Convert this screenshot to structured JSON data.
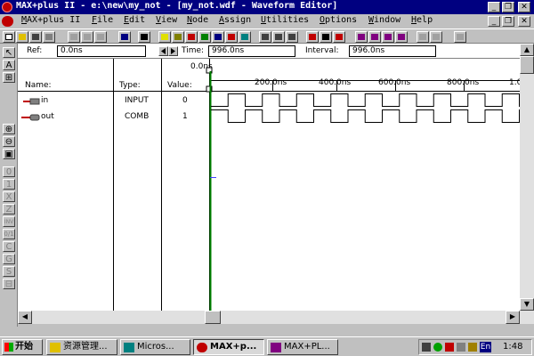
{
  "window": {
    "title": "MAX+plus II - e:\\new\\my_not - [my_not.wdf - Waveform Editor]",
    "controls": [
      "_",
      "❐",
      "✕"
    ],
    "mdi_controls": [
      "_",
      "❐",
      "✕"
    ]
  },
  "menu": [
    "MAX+plus II",
    "File",
    "Edit",
    "View",
    "Node",
    "Assign",
    "Utilities",
    "Options",
    "Window",
    "Help"
  ],
  "refbar": {
    "ref_label": "Ref:",
    "ref_value": "0.0ns",
    "time_label": "Time:",
    "time_value": "996.0ns",
    "interval_label": "Interval:",
    "interval_value": "996.0ns"
  },
  "palette": {
    "tools": [
      "↖",
      "A",
      "⊞",
      "⊕",
      "⊖",
      "▣",
      "0",
      "1",
      "X",
      "Z",
      "INV",
      "0/1",
      "C",
      "G",
      "S",
      "⊟"
    ]
  },
  "waveform": {
    "cursor_label": "0.0ns",
    "headers": {
      "name": "Name:",
      "type": "Type:",
      "value": "Value:"
    },
    "ticks": [
      "200.0ns",
      "400.0ns",
      "600.0ns",
      "800.0ns",
      "1.0"
    ],
    "signals": [
      {
        "name": "in",
        "type": "INPUT",
        "value": "0",
        "direction": "input"
      },
      {
        "name": "out",
        "type": "COMB",
        "value": "1",
        "direction": "output"
      }
    ]
  },
  "taskbar": {
    "start": "开始",
    "tasks": [
      "资源管理...",
      "Micros...",
      "MAX+p...",
      "MAX+PL..."
    ],
    "active_task": 2,
    "language": "En",
    "clock": "1:48"
  },
  "colors": {
    "titlebar": "#000080",
    "window_face": "#c0c0c0",
    "wave_bg": "#ffffff",
    "signal_in": "#c00000",
    "signal_out": "#c00000"
  }
}
